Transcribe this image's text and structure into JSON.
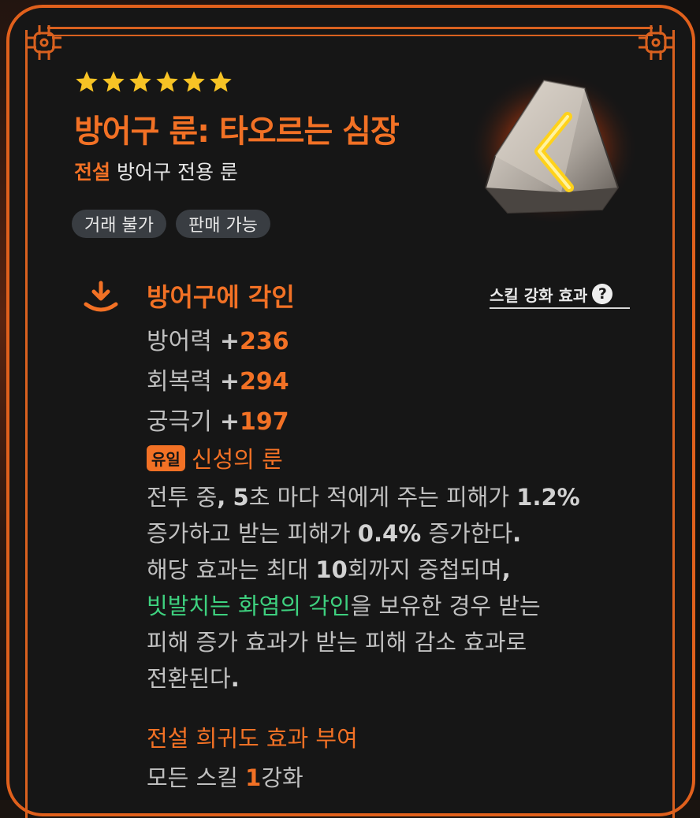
{
  "header": {
    "star_count": 6,
    "title": "방어구 룬: 타오르는 심장",
    "grade": "전설",
    "item_type": "방어구 전용 룬",
    "tags": [
      "거래 불가",
      "판매 가능"
    ],
    "rune_icon": "rune-stone-icon"
  },
  "engrave": {
    "icon": "download-tray-icon",
    "title": "방어구에 각인",
    "skill_link_label": "스킬 강화 효과",
    "stats": [
      {
        "name": "방어력",
        "sign": "+",
        "value": "236"
      },
      {
        "name": "회복력",
        "sign": "+",
        "value": "294"
      },
      {
        "name": "궁극기",
        "sign": "+",
        "value": "197"
      }
    ]
  },
  "unique": {
    "badge": "유일",
    "name": "신성의 룬",
    "desc": {
      "l1a": "전투 중",
      "l1b": ",",
      "l1c": "5",
      "l1d": "초 마다 적에게 주는 피해가",
      "l1e": "1.2%",
      "l2a": "증가하고 받는 피해가",
      "l2b": "0.4%",
      "l2c": "증가한다",
      "l2d": ".",
      "l3a": "해당 효과는 최대",
      "l3b": "10",
      "l3c": "회까지 중첩되며",
      "l3d": ",",
      "l4a": "빗발치는 화염의 각인",
      "l4b": "을 보유한 경우 받는",
      "l5": "피해 증가 효과가 받는 피해 감소 효과로",
      "l6a": "전환된다",
      "l6b": "."
    }
  },
  "grade_effect": {
    "title": "전설 희귀도 효과 부여",
    "line_prefix": "모든 스킬",
    "line_num": "1",
    "line_suffix": "강화"
  },
  "colors": {
    "accent": "#f27125",
    "green": "#3ed17f",
    "star": "#f7c325",
    "tag_bg": "#393d42"
  }
}
